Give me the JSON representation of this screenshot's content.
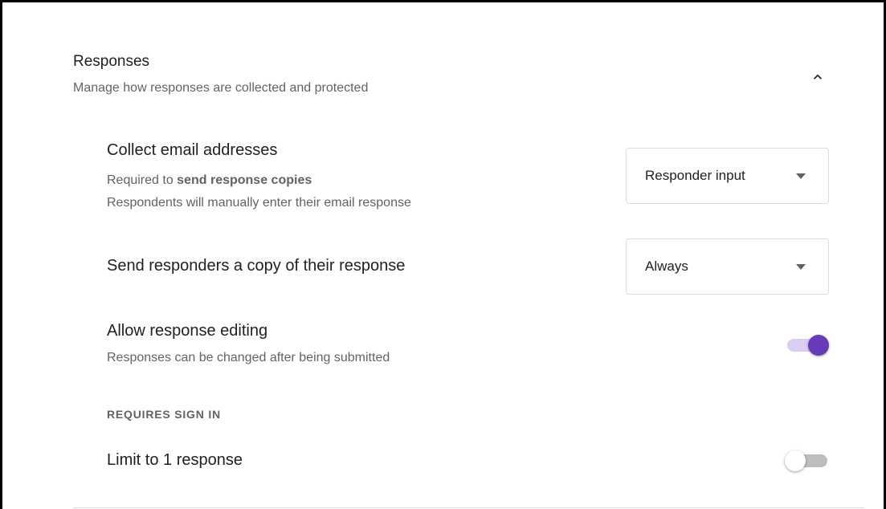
{
  "section": {
    "title": "Responses",
    "subtitle": "Manage how responses are collected and protected",
    "collapse_icon": "chevron-up-icon",
    "expanded": true
  },
  "settings": {
    "collect_email": {
      "title": "Collect email addresses",
      "desc_prefix": "Required to ",
      "desc_bold": "send response copies",
      "desc_line2": "Respondents will manually enter their email response",
      "select_value": "Responder input",
      "select_icon": "dropdown-arrow-icon"
    },
    "send_copy": {
      "title": "Send responders a copy of their response",
      "select_value": "Always",
      "select_icon": "dropdown-arrow-icon"
    },
    "allow_editing": {
      "title": "Allow response editing",
      "desc": "Responses can be changed after being submitted",
      "enabled": true
    },
    "requires_sign_in": {
      "label": "REQUIRES SIGN IN",
      "limit_one": {
        "title": "Limit to 1 response",
        "enabled": false
      }
    }
  },
  "colors": {
    "accent": "#673ab7",
    "accent_track": "#d9cdf0",
    "off_track": "#bdbdbd",
    "text_primary": "#202124",
    "text_secondary": "#5f6368",
    "border": "#dadce0"
  }
}
